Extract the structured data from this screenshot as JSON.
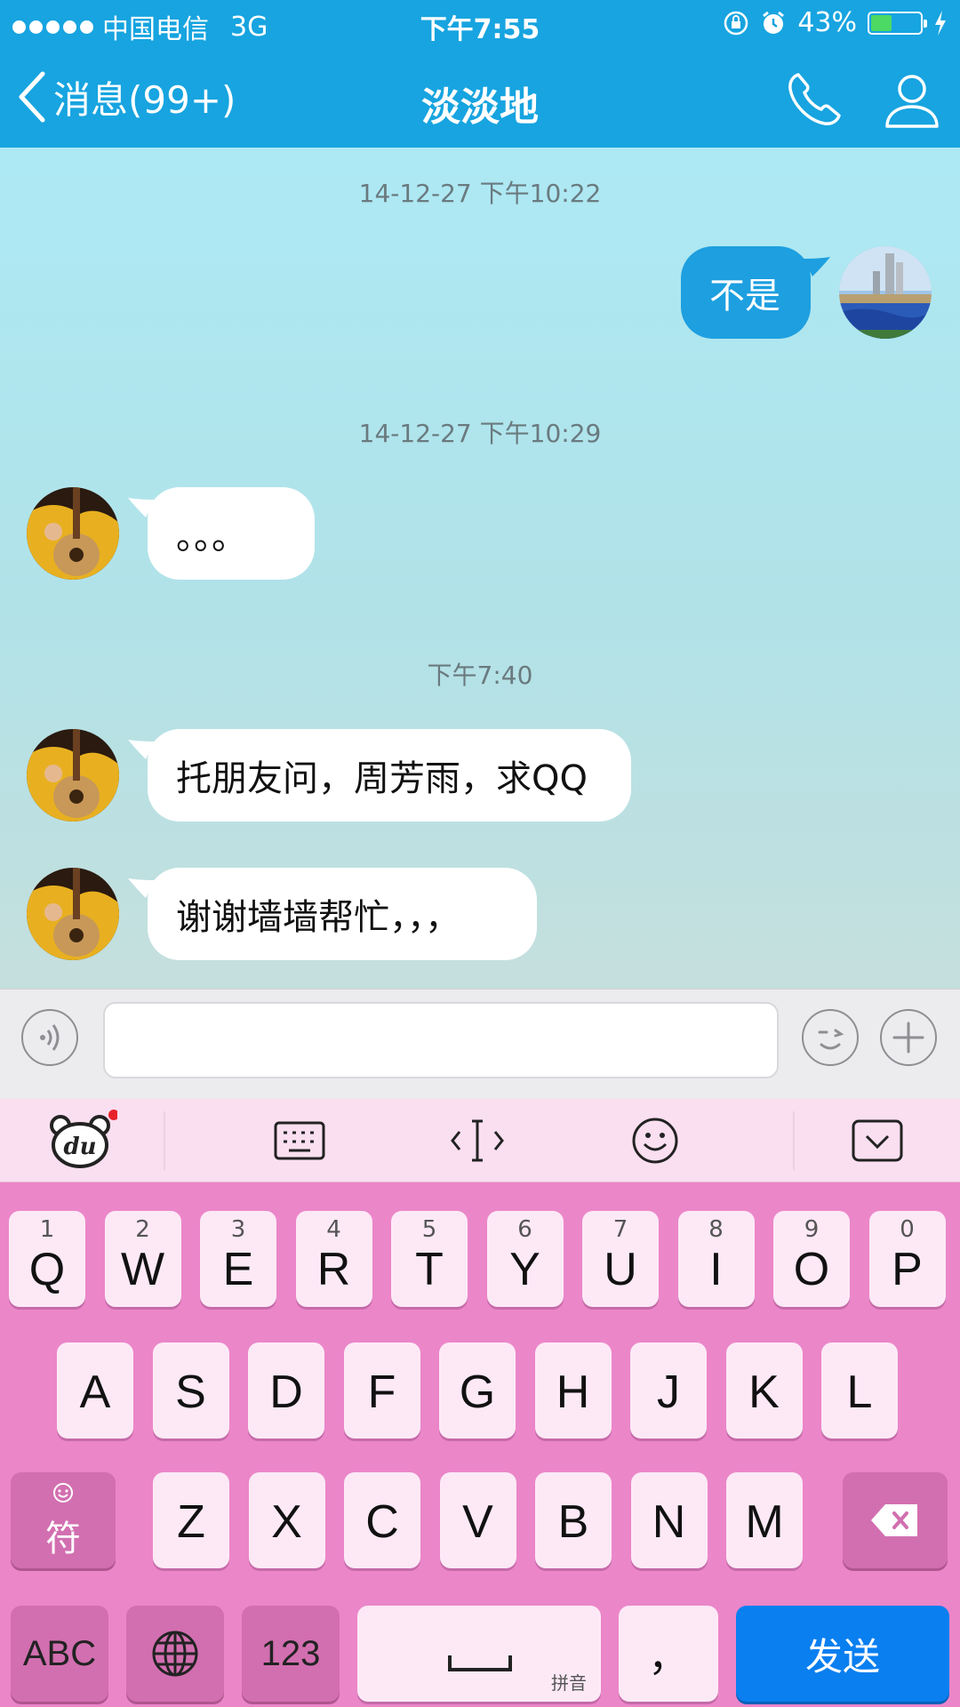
{
  "status_bar": {
    "carrier": "中国电信",
    "network": "3G",
    "time": "下午7:55",
    "battery": "43%",
    "battery_level": 0.43
  },
  "nav": {
    "back_label": "消息(99+)",
    "title": "淡淡地"
  },
  "chat": {
    "timestamps": [
      "14-12-27 下午10:22",
      "14-12-27 下午10:29",
      "下午7:40"
    ],
    "messages": [
      {
        "text": "不是",
        "direction": "outgoing"
      },
      {
        "text": "。。。",
        "direction": "incoming"
      },
      {
        "text": "托朋友问，周芳雨，求QQ",
        "direction": "incoming"
      },
      {
        "text": "谢谢墙墙帮忙，，，",
        "direction": "incoming"
      }
    ]
  },
  "input": {
    "value": "",
    "placeholder": ""
  },
  "keyboard": {
    "toolbar_icons": [
      "du-bear-icon",
      "keyboard-icon",
      "cursor-icon",
      "emoji-icon",
      "collapse-icon"
    ],
    "row1": [
      {
        "num": "1",
        "letter": "Q"
      },
      {
        "num": "2",
        "letter": "W"
      },
      {
        "num": "3",
        "letter": "E"
      },
      {
        "num": "4",
        "letter": "R"
      },
      {
        "num": "5",
        "letter": "T"
      },
      {
        "num": "6",
        "letter": "Y"
      },
      {
        "num": "7",
        "letter": "U"
      },
      {
        "num": "8",
        "letter": "I"
      },
      {
        "num": "9",
        "letter": "O"
      },
      {
        "num": "0",
        "letter": "P"
      }
    ],
    "row2": [
      "A",
      "S",
      "D",
      "F",
      "G",
      "H",
      "J",
      "K",
      "L"
    ],
    "row3": [
      "Z",
      "X",
      "C",
      "V",
      "B",
      "N",
      "M"
    ],
    "symbol_key": "符",
    "abc_key": "ABC",
    "num_key": "123",
    "space_hint": "拼音",
    "comma_key": "，",
    "send_key": "发送"
  },
  "colors": {
    "header": "#17a4e0",
    "outgoing_bubble": "#1d9fe0",
    "keyboard_bg": "#eb86c9",
    "send_key": "#0a7ff0"
  }
}
